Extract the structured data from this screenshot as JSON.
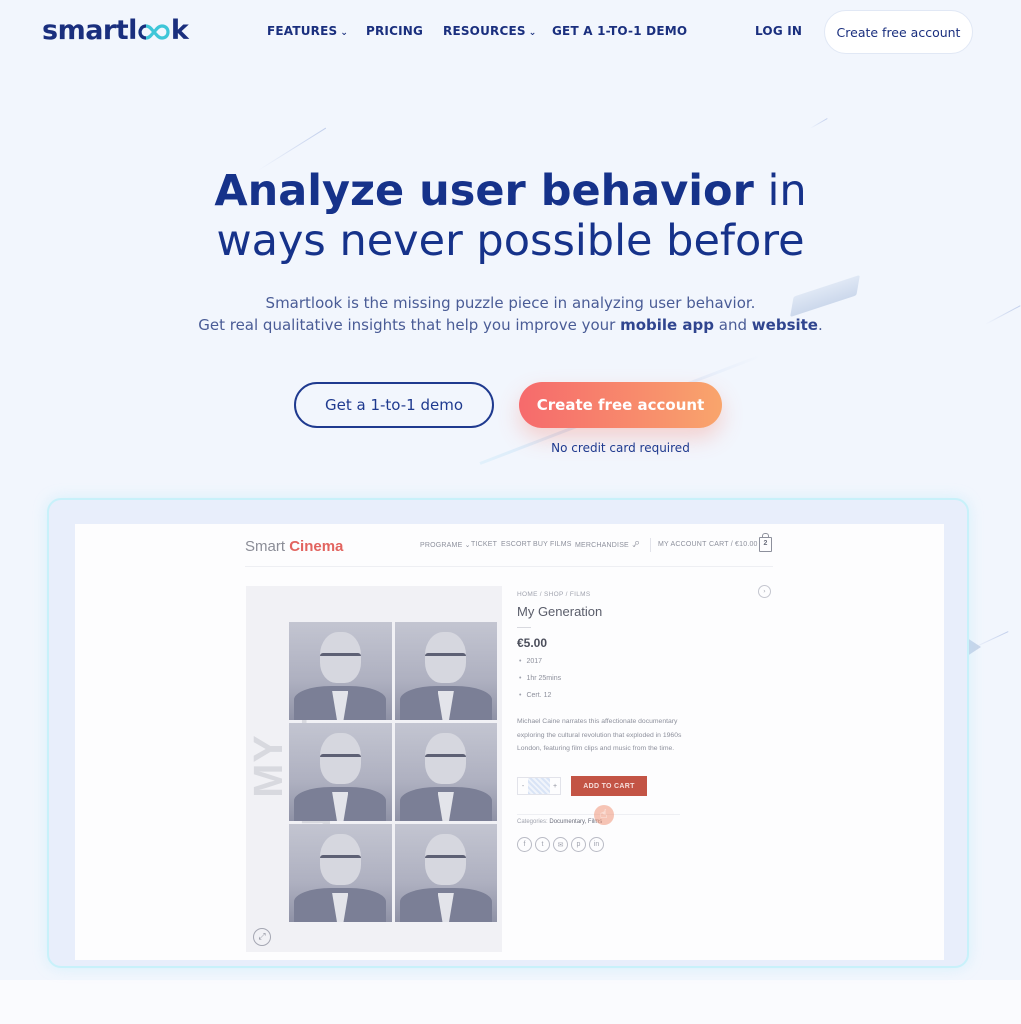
{
  "nav": {
    "logo": {
      "pre": "smartl",
      "post": "k"
    },
    "items": [
      {
        "label": "FEATURES",
        "has_dropdown": true
      },
      {
        "label": "PRICING",
        "has_dropdown": false
      },
      {
        "label": "RESOURCES",
        "has_dropdown": true
      },
      {
        "label": "GET A 1-TO-1 DEMO",
        "has_dropdown": false
      }
    ],
    "login": "LOG IN",
    "cta": "Create free account",
    "chevron": "⌄"
  },
  "hero": {
    "title_bold": "Analyze user behavior",
    "title_light_1": " in",
    "title_light_2": "ways never possible before",
    "sub_line1": "Smartlook is the missing puzzle piece in analyzing user behavior.",
    "sub_line2_pre": "Get real qualitative insights that help you improve your ",
    "sub_bold1": "mobile app",
    "sub_mid": " and ",
    "sub_bold2": "website",
    "sub_end": ".",
    "btn_demo": "Get a 1-to-1 demo",
    "btn_create": "Create free account",
    "no_cc": "No credit card required"
  },
  "colors": {
    "brand_navy": "#16328a",
    "cta_gradient_start": "#f66a6c",
    "cta_gradient_end": "#f9a56c",
    "logo_accent": "#3ec6d8",
    "cinema_red": "#e2645f",
    "add_to_cart": "#c35445"
  },
  "demo_site": {
    "logo_pre": "Smart ",
    "logo_accent": "Cinema",
    "nav": [
      {
        "label": "PROGRAME ⌄"
      },
      {
        "label": "TICKET"
      },
      {
        "label": "ESCORT"
      },
      {
        "label": "BUY FILMS"
      },
      {
        "label": "MERCHANDISE ⌄"
      }
    ],
    "search_icon": "⌕",
    "my_account": "MY ACCOUNT",
    "cart": "CART / €10.00",
    "cart_count": "2",
    "breadcrumb": "HOME / SHOP / FILMS",
    "product_title": "My Generation",
    "price": "€5.00",
    "meta": [
      "2017",
      "1hr 25mins",
      "Cert. 12"
    ],
    "description": "Michael Caine narrates this affectionate documentary exploring the cultural revolution that exploded in 1960s London, featuring film clips and music from the time.",
    "qty_minus": "-",
    "qty_plus": "+",
    "add_to_cart": "ADD TO CART",
    "categories_label": "Categories: ",
    "categories_value": "Documentary, Films",
    "poster_text": "MY GENERATION",
    "social": [
      "f",
      "t",
      "✉",
      "p",
      "in"
    ],
    "expand_icon": "⤢",
    "next_icon": "›",
    "cursor_icon": "☝"
  }
}
